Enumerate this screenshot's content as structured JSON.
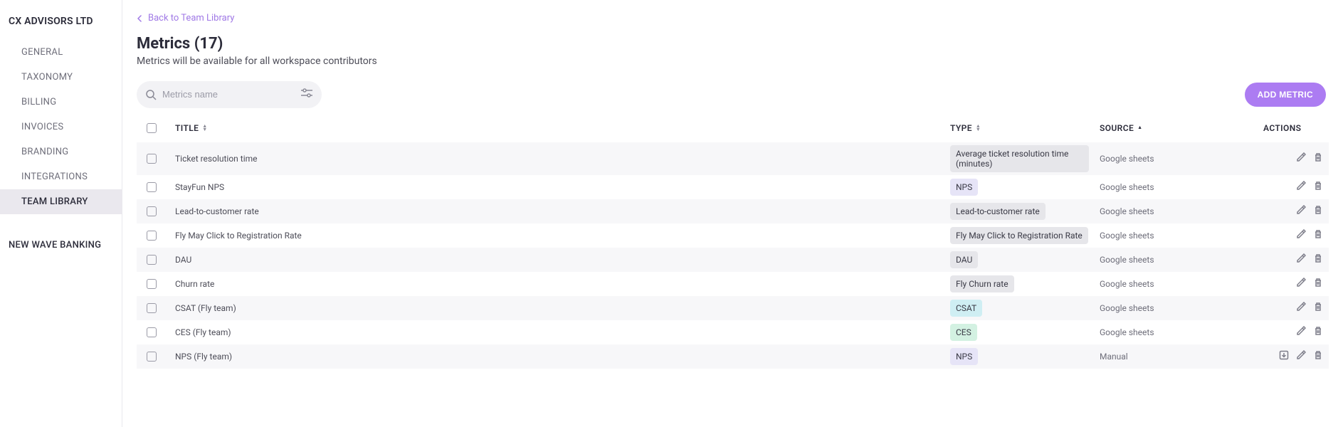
{
  "sidebar": {
    "org": "CX ADVISORS LTD",
    "items": [
      {
        "label": "GENERAL"
      },
      {
        "label": "TAXONOMY"
      },
      {
        "label": "BILLING"
      },
      {
        "label": "INVOICES"
      },
      {
        "label": "BRANDING"
      },
      {
        "label": "INTEGRATIONS"
      },
      {
        "label": "TEAM LIBRARY",
        "active": true
      }
    ],
    "secondary": [
      {
        "label": "NEW WAVE BANKING"
      }
    ]
  },
  "back_link": "Back to Team Library",
  "page": {
    "title": "Metrics (17)",
    "subtitle": "Metrics will be available for all workspace contributors"
  },
  "search": {
    "placeholder": "Metrics name"
  },
  "add_button": "ADD METRIC",
  "columns": {
    "title": "TITLE",
    "type": "TYPE",
    "source": "SOURCE",
    "actions": "ACTIONS"
  },
  "rows": [
    {
      "title": "Ticket resolution time",
      "type_label": "Average ticket resolution time (minutes)",
      "type_color": "gray",
      "source": "Google sheets",
      "download": false
    },
    {
      "title": "StayFun NPS",
      "type_label": "NPS",
      "type_color": "violet",
      "source": "Google sheets",
      "download": false
    },
    {
      "title": "Lead-to-customer rate",
      "type_label": "Lead-to-customer rate",
      "type_color": "gray",
      "source": "Google sheets",
      "download": false
    },
    {
      "title": "Fly May Click to Registration Rate",
      "type_label": "Fly May Click to Registration Rate",
      "type_color": "gray",
      "source": "Google sheets",
      "download": false
    },
    {
      "title": "DAU",
      "type_label": "DAU",
      "type_color": "gray",
      "source": "Google sheets",
      "download": false
    },
    {
      "title": "Churn rate",
      "type_label": "Fly Churn rate",
      "type_color": "gray",
      "source": "Google sheets",
      "download": false
    },
    {
      "title": "CSAT (Fly team)",
      "type_label": "CSAT",
      "type_color": "cyan",
      "source": "Google sheets",
      "download": false
    },
    {
      "title": "CES (Fly team)",
      "type_label": "CES",
      "type_color": "mint",
      "source": "Google sheets",
      "download": false
    },
    {
      "title": "NPS (Fly team)",
      "type_label": "NPS",
      "type_color": "violet",
      "source": "Manual",
      "download": true
    }
  ]
}
